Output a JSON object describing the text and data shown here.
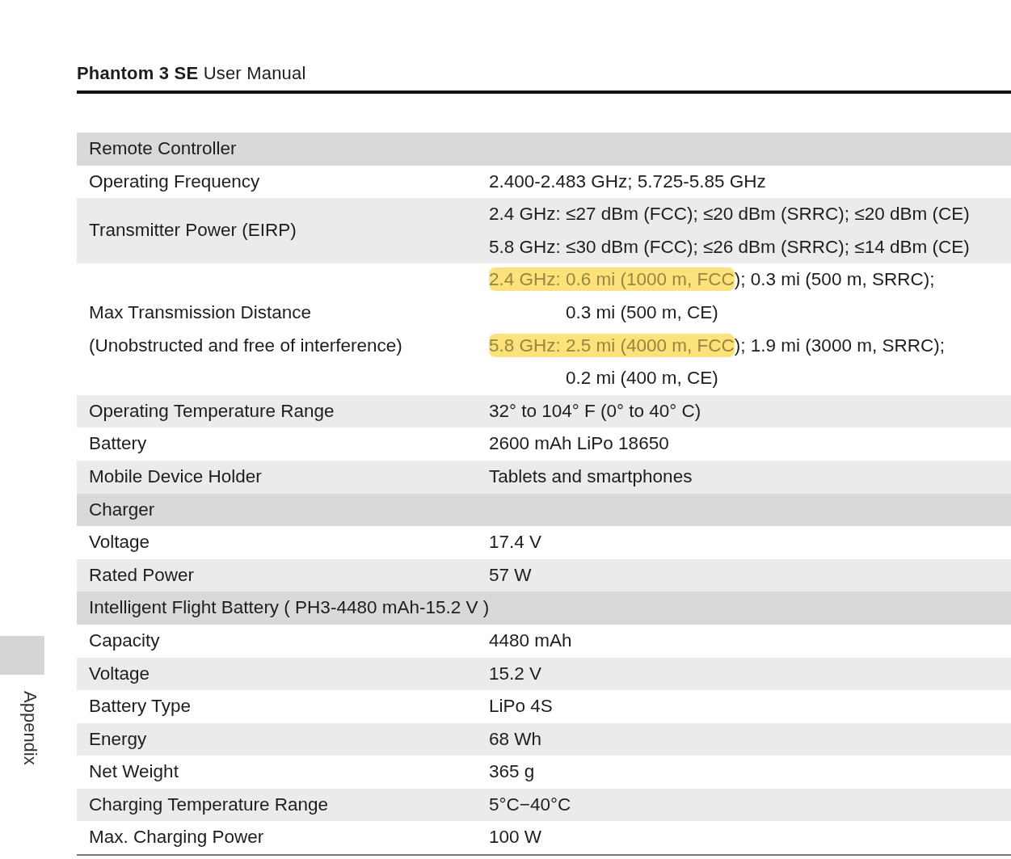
{
  "header": {
    "title": "**Phantom 3 SE** User Manual"
  },
  "side_tab": {
    "label": "Appendix"
  },
  "table": {
    "rows": [
      {
        "kind": "section",
        "label_lines": [
          "Remote Controller"
        ],
        "value_lines": []
      },
      {
        "kind": "spec",
        "label_lines": [
          "Operating Frequency"
        ],
        "value_lines": [
          {
            "kind": "main",
            "parts": [
              {
                "text": "2.400-2.483 GHz; 5.725-5.85 GHz",
                "highlighted": false
              }
            ]
          }
        ]
      },
      {
        "kind": "spec",
        "label_lines": [
          "Transmitter Power (EIRP)"
        ],
        "value_lines": [
          {
            "kind": "main",
            "parts": [
              {
                "text": "2.4 GHz: ≤27 dBm (FCC); ≤20 dBm (SRRC); ≤20 dBm (CE)",
                "highlighted": false
              }
            ]
          },
          {
            "kind": "main",
            "parts": [
              {
                "text": "5.8 GHz: ≤30 dBm (FCC); ≤26 dBm (SRRC); ≤14 dBm (CE)",
                "highlighted": false
              }
            ]
          }
        ]
      },
      {
        "kind": "spec",
        "label_lines": [
          "Max Transmission Distance",
          "(Unobstructed and free of interference)"
        ],
        "value_lines": [
          {
            "kind": "main",
            "parts": [
              {
                "text": "2.4 GHz: 0.6 mi (1000 m, FCC",
                "highlighted": true
              },
              {
                "text": ");  0.3 mi (500 m, SRRC);",
                "highlighted": false
              }
            ]
          },
          {
            "kind": "continuation",
            "parts": [
              {
                "text": "0.3 mi (500 m, CE)",
                "highlighted": false
              }
            ]
          },
          {
            "kind": "main",
            "parts": [
              {
                "text": "5.8 GHz: 2.5 mi (4000 m, FCC",
                "highlighted": true
              },
              {
                "text": ");  1.9 mi (3000 m, SRRC);",
                "highlighted": false
              }
            ]
          },
          {
            "kind": "continuation",
            "parts": [
              {
                "text": "0.2 mi (400 m, CE)",
                "highlighted": false
              }
            ]
          }
        ]
      },
      {
        "kind": "spec",
        "label_lines": [
          "Operating Temperature Range"
        ],
        "value_lines": [
          {
            "kind": "main",
            "parts": [
              {
                "text": "32° to 104° F (0° to 40° C)",
                "highlighted": false
              }
            ]
          }
        ]
      },
      {
        "kind": "spec",
        "label_lines": [
          "Battery"
        ],
        "value_lines": [
          {
            "kind": "main",
            "parts": [
              {
                "text": "2600 mAh LiPo 18650",
                "highlighted": false
              }
            ]
          }
        ]
      },
      {
        "kind": "spec",
        "label_lines": [
          "Mobile Device Holder"
        ],
        "value_lines": [
          {
            "kind": "main",
            "parts": [
              {
                "text": "Tablets and smartphones",
                "highlighted": false
              }
            ]
          }
        ]
      },
      {
        "kind": "section",
        "label_lines": [
          "Charger"
        ],
        "value_lines": []
      },
      {
        "kind": "spec",
        "label_lines": [
          "Voltage"
        ],
        "value_lines": [
          {
            "kind": "main",
            "parts": [
              {
                "text": "17.4 V",
                "highlighted": false
              }
            ]
          }
        ]
      },
      {
        "kind": "spec",
        "label_lines": [
          "Rated Power"
        ],
        "value_lines": [
          {
            "kind": "main",
            "parts": [
              {
                "text": "57 W",
                "highlighted": false
              }
            ]
          }
        ]
      },
      {
        "kind": "section",
        "label_lines": [
          "Intelligent Flight Battery ( PH3-4480 mAh-15.2 V )"
        ],
        "value_lines": []
      },
      {
        "kind": "spec",
        "label_lines": [
          "Capacity"
        ],
        "value_lines": [
          {
            "kind": "main",
            "parts": [
              {
                "text": "4480 mAh",
                "highlighted": false
              }
            ]
          }
        ]
      },
      {
        "kind": "spec",
        "label_lines": [
          "Voltage"
        ],
        "value_lines": [
          {
            "kind": "main",
            "parts": [
              {
                "text": "15.2 V",
                "highlighted": false
              }
            ]
          }
        ]
      },
      {
        "kind": "spec",
        "label_lines": [
          "Battery Type"
        ],
        "value_lines": [
          {
            "kind": "main",
            "parts": [
              {
                "text": "LiPo 4S",
                "highlighted": false
              }
            ]
          }
        ]
      },
      {
        "kind": "spec",
        "label_lines": [
          "Energy"
        ],
        "value_lines": [
          {
            "kind": "main",
            "parts": [
              {
                "text": "68 Wh",
                "highlighted": false
              }
            ]
          }
        ]
      },
      {
        "kind": "spec",
        "label_lines": [
          "Net Weight"
        ],
        "value_lines": [
          {
            "kind": "main",
            "parts": [
              {
                "text": "365 g",
                "highlighted": false
              }
            ]
          }
        ]
      },
      {
        "kind": "spec",
        "label_lines": [
          "Charging Temperature Range"
        ],
        "value_lines": [
          {
            "kind": "main",
            "parts": [
              {
                "text": "5°C−40°C",
                "highlighted": false
              }
            ]
          }
        ]
      },
      {
        "kind": "spec",
        "label_lines": [
          "Max. Charging Power"
        ],
        "value_lines": [
          {
            "kind": "main",
            "parts": [
              {
                "text": "100 W",
                "highlighted": false
              }
            ]
          }
        ]
      }
    ]
  }
}
